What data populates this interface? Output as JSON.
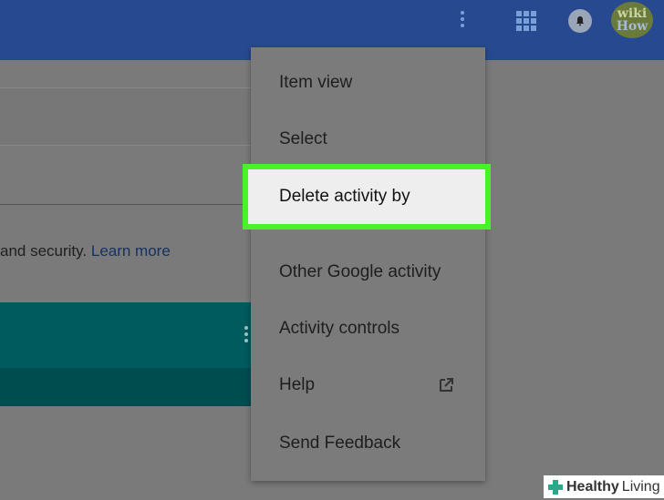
{
  "menu": {
    "items": [
      {
        "label": "Item view"
      },
      {
        "label": "Select"
      },
      {
        "label": "Delete activity by"
      },
      {
        "label": "Other Google activity"
      },
      {
        "label": "Activity controls"
      },
      {
        "label": "Help"
      },
      {
        "label": "Send Feedback"
      }
    ]
  },
  "main": {
    "info_text": "and security.",
    "learn_more": "Learn more"
  },
  "avatar": {
    "line1": "wiki",
    "line2": "How"
  },
  "badge": {
    "part1": "Healthy",
    "part2": "Living"
  },
  "colors": {
    "topbar": "#27498f",
    "highlight": "#48f128",
    "teal": "#005b5e",
    "badge_cross": "#2aa88a"
  }
}
